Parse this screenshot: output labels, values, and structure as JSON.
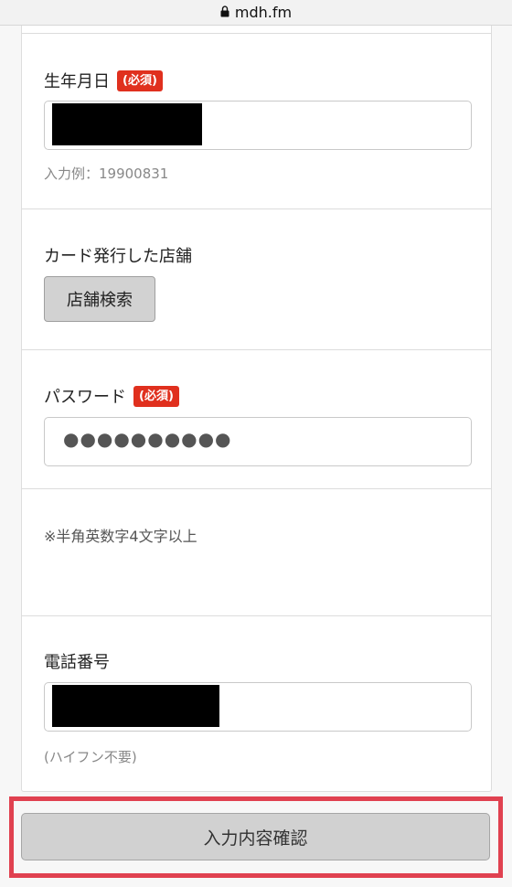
{
  "browser": {
    "url_host": "mdh.fm"
  },
  "birthday": {
    "label": "生年月日",
    "required_badge": "(必須)",
    "hint": "入力例：19900831"
  },
  "store": {
    "label": "カード発行した店舗",
    "search_button": "店舗検索"
  },
  "password": {
    "label": "パスワード",
    "required_badge": "(必須)",
    "masked_value": "●●●●●●●●●●",
    "note": "※半角英数字4文字以上"
  },
  "phone": {
    "label": "電話番号",
    "hint": "(ハイフン不要)"
  },
  "submit": {
    "label": "入力内容確認"
  },
  "colors": {
    "required_badge": "#e0301e",
    "highlight_frame": "#e04150",
    "button_gray": "#d1d1d1"
  }
}
